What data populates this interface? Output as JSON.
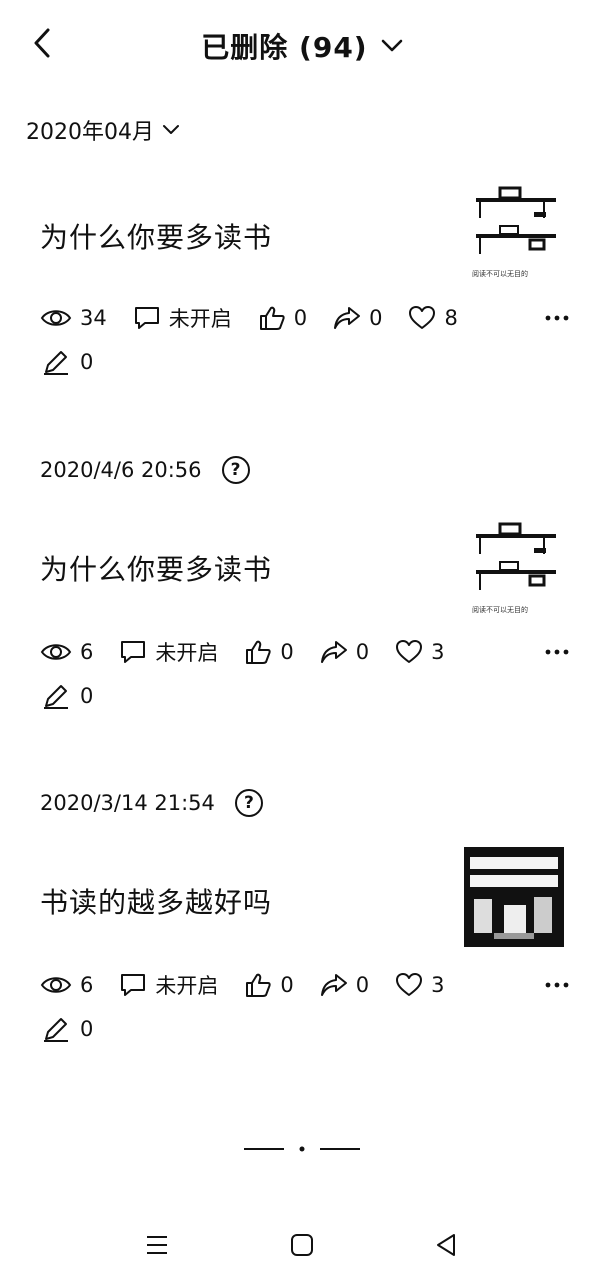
{
  "header": {
    "title": "已删除 (94)"
  },
  "month": {
    "label": "2020年04月"
  },
  "posts": [
    {
      "date": "",
      "title": "为什么你要多读书",
      "thumb_caption": "阅读不可以无目的",
      "views": "34",
      "comments": "未开启",
      "likes": "0",
      "shares": "0",
      "favorites": "8",
      "edits": "0"
    },
    {
      "date": "2020/4/6 20:56",
      "help": "?",
      "title": "为什么你要多读书",
      "thumb_caption": "阅读不可以无目的",
      "views": "6",
      "comments": "未开启",
      "likes": "0",
      "shares": "0",
      "favorites": "3",
      "edits": "0"
    },
    {
      "date": "2020/3/14 21:54",
      "help": "?",
      "title": "书读的越多越好吗",
      "views": "6",
      "comments": "未开启",
      "likes": "0",
      "shares": "0",
      "favorites": "3",
      "edits": "0"
    }
  ],
  "icons": {
    "back": "chevron-left-icon",
    "title_dropdown": "chevron-down-icon",
    "views": "eye-icon",
    "comments": "comment-icon",
    "likes": "thumbs-up-icon",
    "shares": "share-icon",
    "favorites": "heart-icon",
    "edits": "pencil-icon",
    "more": "more-dots-icon"
  }
}
